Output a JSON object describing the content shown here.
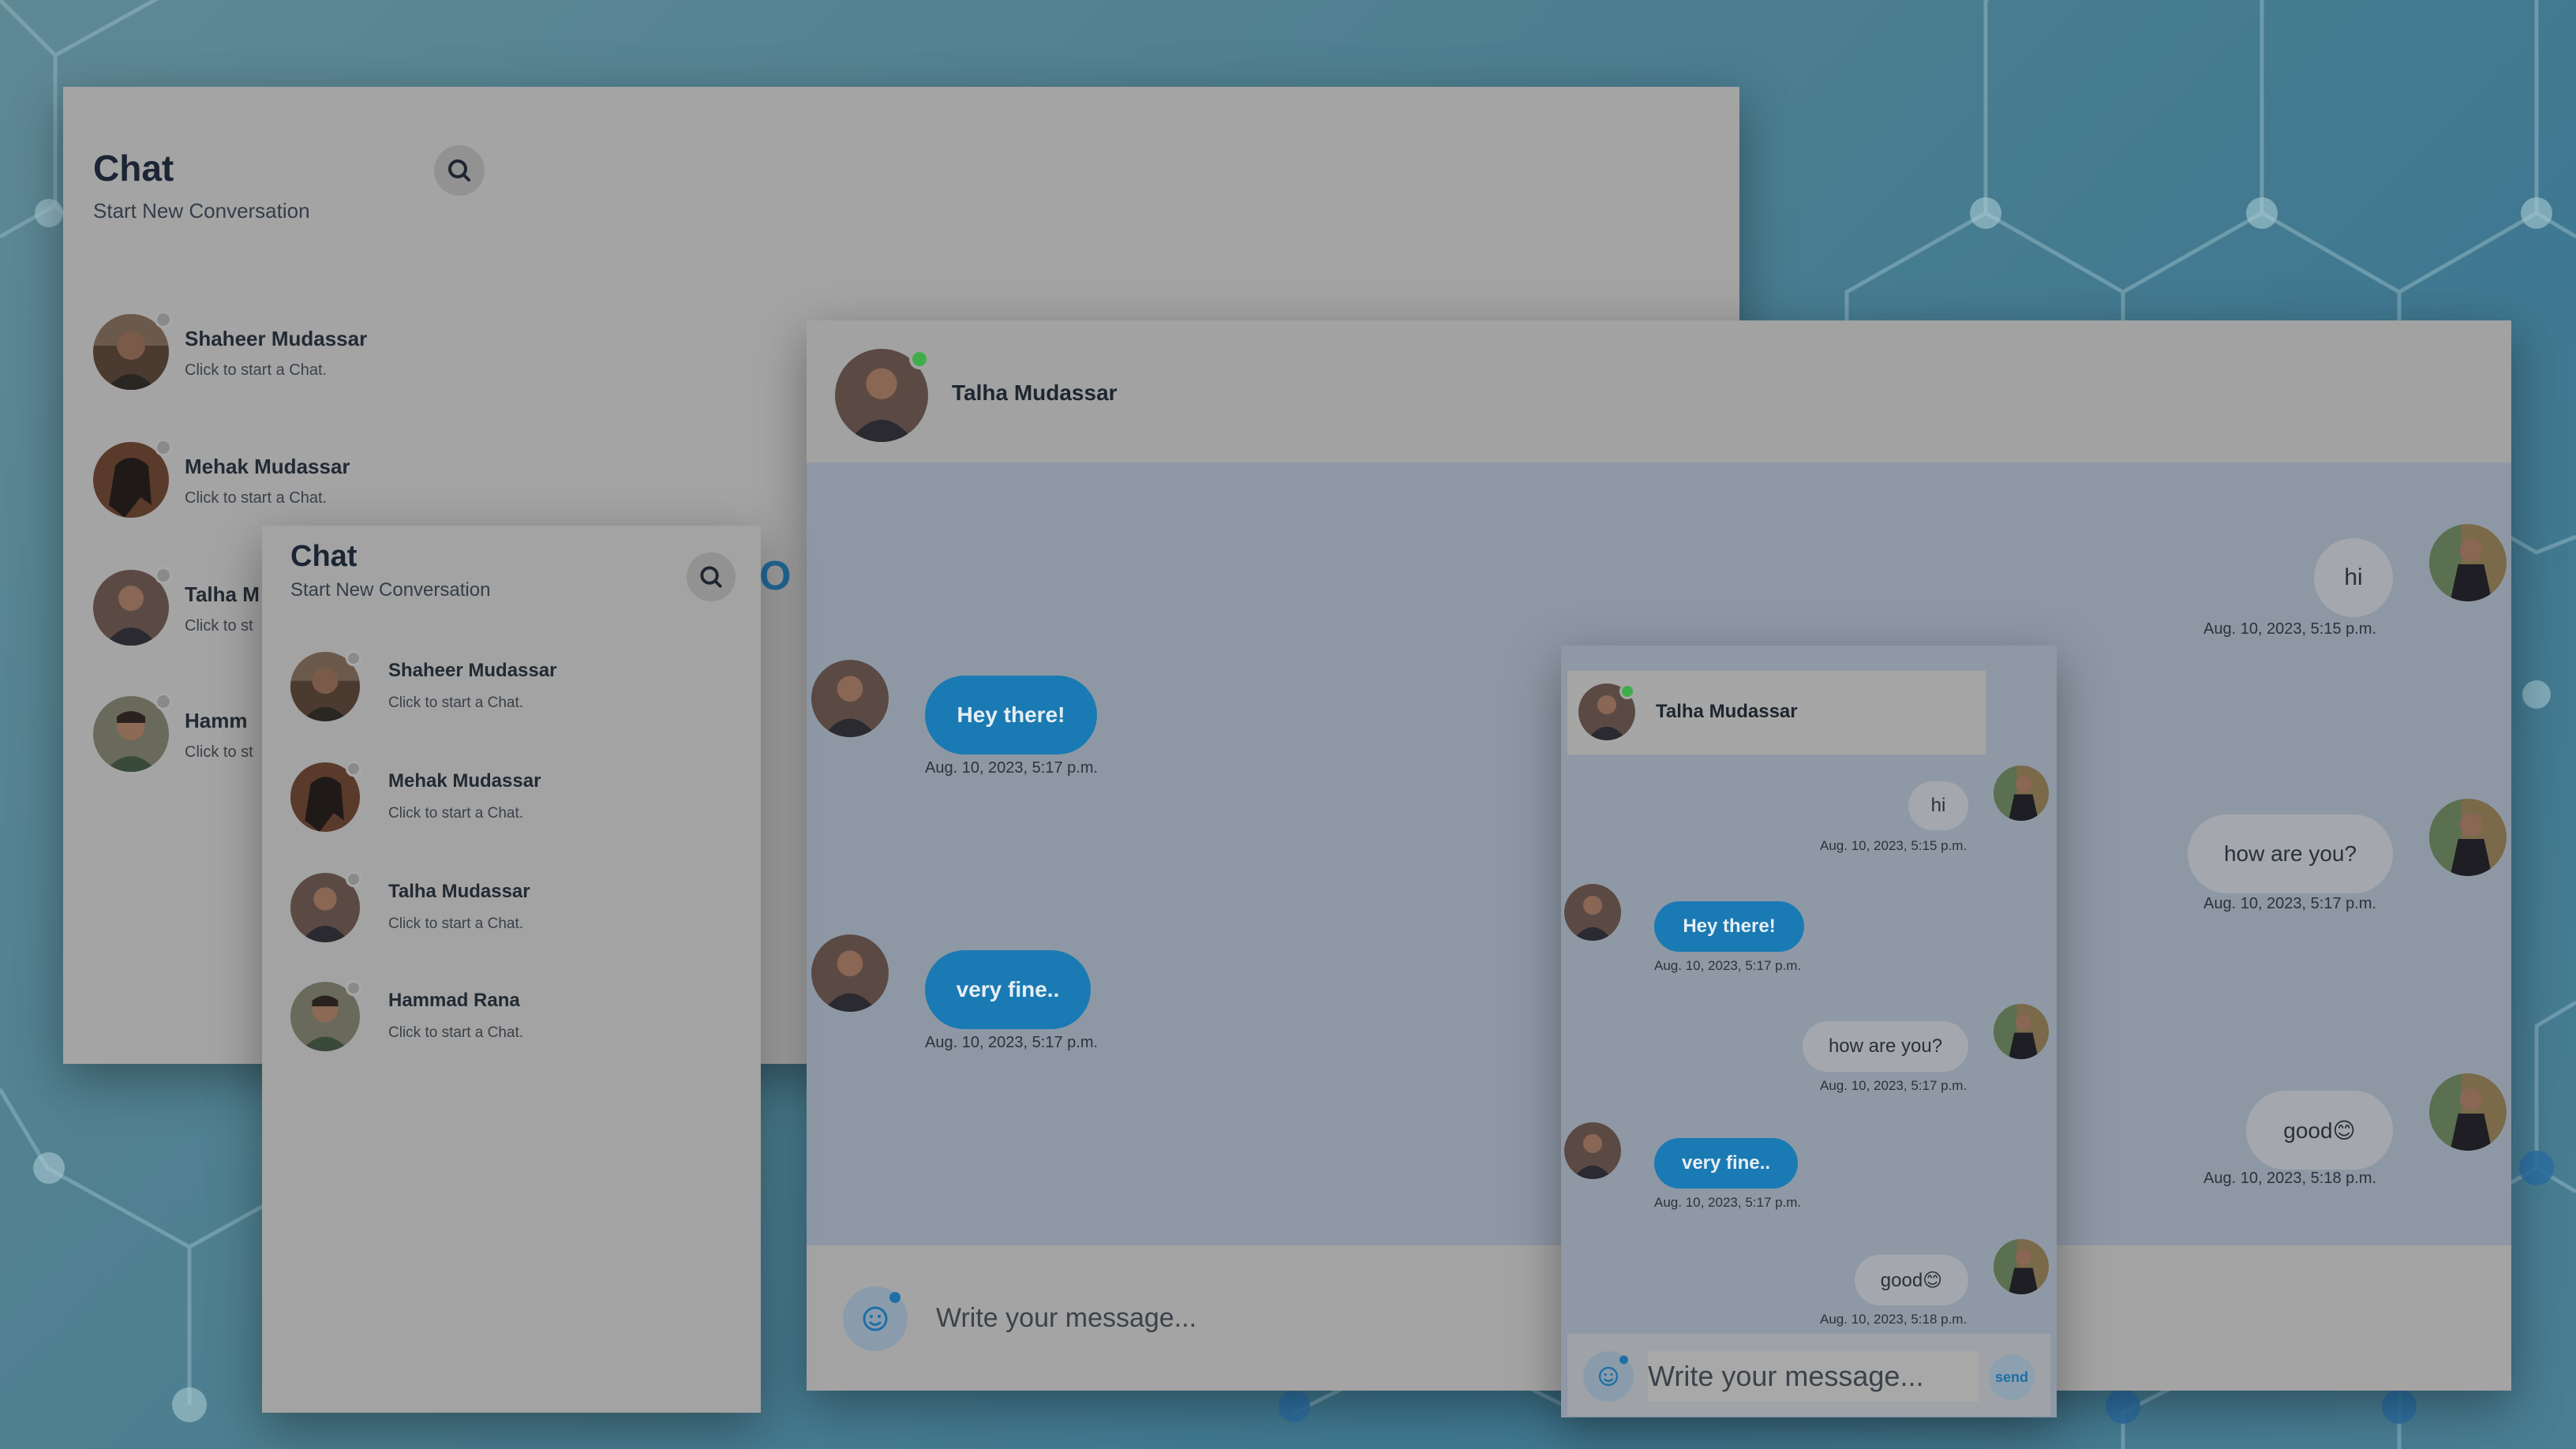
{
  "chat_list_large": {
    "title": "Chat",
    "subtitle": "Start New Conversation",
    "contacts": [
      {
        "name": "Shaheer Mudassar",
        "hint": "Click to start a Chat."
      },
      {
        "name": "Mehak Mudassar",
        "hint": "Click to start a Chat."
      },
      {
        "name": "Talha M",
        "hint": "Click to st"
      },
      {
        "name": "Hamm",
        "hint": "Click to st"
      }
    ]
  },
  "chat_list_small": {
    "title": "Chat",
    "subtitle": "Start New Conversation",
    "contacts": [
      {
        "name": "Shaheer Mudassar",
        "hint": "Click to start a Chat."
      },
      {
        "name": "Mehak Mudassar",
        "hint": "Click to start a Chat."
      },
      {
        "name": "Talha Mudassar",
        "hint": "Click to start a Chat."
      },
      {
        "name": "Hammad Rana",
        "hint": "Click to start a Chat."
      }
    ]
  },
  "conversation_large": {
    "contact_name": "Talha Mudassar",
    "messages": [
      {
        "dir": "out",
        "text": "hi",
        "time": "Aug. 10, 2023, 5:15 p.m."
      },
      {
        "dir": "in",
        "text": "Hey there!",
        "time": "Aug. 10, 2023, 5:17 p.m."
      },
      {
        "dir": "out",
        "text": "how are you?",
        "time": "Aug. 10, 2023, 5:17 p.m."
      },
      {
        "dir": "in",
        "text": "very fine..",
        "time": "Aug. 10, 2023, 5:17 p.m."
      },
      {
        "dir": "out",
        "text": "good😊",
        "time": "Aug. 10, 2023, 5:18 p.m."
      }
    ],
    "composer_placeholder": "Write your message..."
  },
  "conversation_small": {
    "contact_name": "Talha Mudassar",
    "messages": [
      {
        "dir": "out",
        "text": "hi",
        "time": "Aug. 10, 2023, 5:15 p.m."
      },
      {
        "dir": "in",
        "text": "Hey there!",
        "time": "Aug. 10, 2023, 5:17 p.m."
      },
      {
        "dir": "out",
        "text": "how are you?",
        "time": "Aug. 10, 2023, 5:17 p.m."
      },
      {
        "dir": "in",
        "text": "very fine..",
        "time": "Aug. 10, 2023, 5:17 p.m."
      },
      {
        "dir": "out",
        "text": "good😊",
        "time": "Aug. 10, 2023, 5:18 p.m."
      }
    ],
    "composer_placeholder": "Write your message...",
    "send_label": "send"
  },
  "icons": {
    "search": "search-icon",
    "emoji": "emoji-icon",
    "avatar": "avatar-photo"
  },
  "colors": {
    "incoming_bubble": "#1a7ab3",
    "outgoing_bubble": "#a4a8ae",
    "online_dot": "#3fae4a",
    "background": "#4d7f90"
  }
}
